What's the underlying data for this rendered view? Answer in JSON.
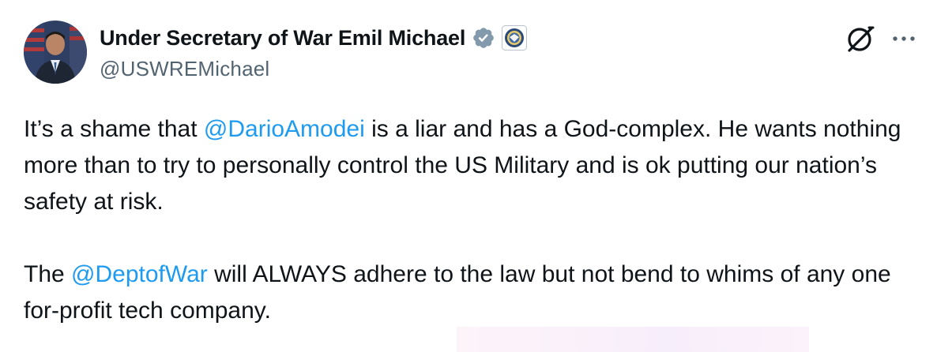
{
  "author": {
    "display_name": "Under Secretary of War Emil Michael",
    "handle": "@USWREMichael",
    "avatar": "avatar",
    "verified_icon": "verified-badge-icon",
    "affiliation_icon": "department-seal-icon"
  },
  "actions": {
    "grok_icon": "grok-slash-icon",
    "more_icon": "more-horizontal-icon"
  },
  "post": {
    "paragraph_1": {
      "part_1": "It’s a shame that ",
      "mention_1": "@DarioAmodei",
      "part_2": " is a liar and has a God-complex. He wants nothing more than to try to personally control the US Military and is ok putting our nation’s safety at risk."
    },
    "paragraph_2": {
      "part_1": "The ",
      "mention_1": "@DeptofWar",
      "part_2": " will ALWAYS adhere to the law but not bend to whims of any one for-profit tech company."
    }
  },
  "colors": {
    "text": "#0f1419",
    "secondary": "#536471",
    "link": "#1d9bf0",
    "verified": "#829aab"
  }
}
